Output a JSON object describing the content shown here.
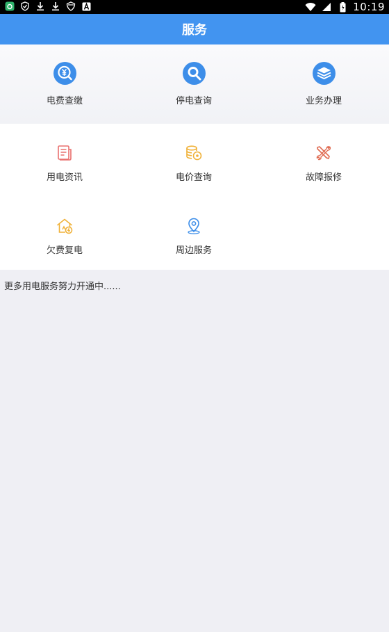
{
  "status_bar": {
    "time": "10:19",
    "left_icons": [
      "app-icon",
      "shield-check-icon",
      "download-icon",
      "download-icon",
      "vpn-shield-icon",
      "a-letter-icon"
    ],
    "right_icons": [
      "wifi-icon",
      "signal-icon",
      "battery-icon"
    ]
  },
  "header": {
    "title": "服务"
  },
  "top_services": [
    {
      "label": "电费查缴",
      "icon": "yuan-search-icon"
    },
    {
      "label": "停电查询",
      "icon": "magnifier-icon"
    },
    {
      "label": "业务办理",
      "icon": "layers-icon"
    }
  ],
  "grid_services": [
    {
      "label": "用电资讯",
      "icon": "news-document-icon",
      "color": "#e9706e"
    },
    {
      "label": "电价查询",
      "icon": "coin-stack-icon",
      "color": "#f0b23a"
    },
    {
      "label": "故障报修",
      "icon": "tools-icon",
      "color": "#e06d54"
    },
    {
      "label": "欠费复电",
      "icon": "house-power-icon",
      "color": "#f0b23a"
    },
    {
      "label": "周边服务",
      "icon": "location-pin-icon",
      "color": "#3d8ee9"
    }
  ],
  "notice": {
    "text": "更多用电服务努力开通中......"
  },
  "colors": {
    "primary": "#4294f0",
    "icon_blue": "#3d8ee9",
    "background": "#efeff4"
  }
}
